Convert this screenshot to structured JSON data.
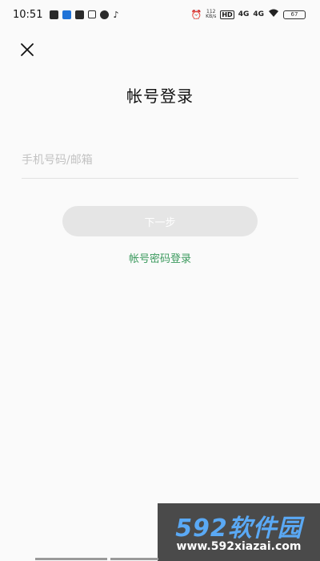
{
  "status_bar": {
    "time": "10:51",
    "net_speed_top": "112",
    "net_speed_bottom": "KB/s",
    "hd_label": "HD",
    "signal_1": "4G",
    "signal_2": "4G",
    "battery": "67"
  },
  "close_icon": "close-icon",
  "title": "帐号登录",
  "account_input": {
    "placeholder": "手机号码/邮箱",
    "value": ""
  },
  "next_button": {
    "label": "下一步"
  },
  "password_login_link": {
    "label": "帐号密码登录"
  },
  "watermark": {
    "logo": "592软件园",
    "url": "www.592xiazai.com"
  },
  "colors": {
    "background": "#fafafa",
    "link_green": "#3c9a5e",
    "button_disabled": "#e5e5e5"
  }
}
